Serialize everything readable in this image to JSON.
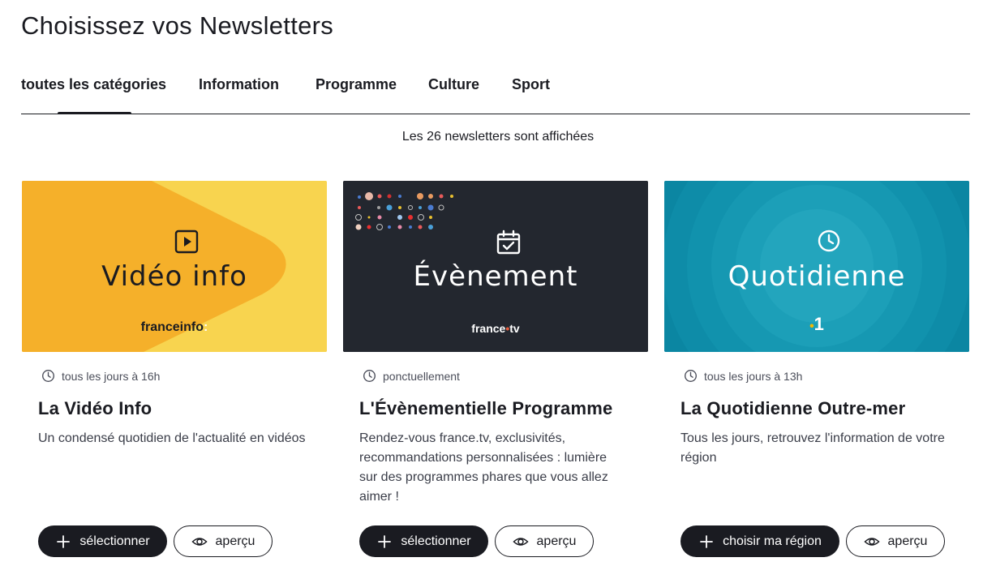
{
  "page": {
    "title": "Choisissez vos Newsletters",
    "count_text": "Les 26 newsletters sont affichées"
  },
  "tabs": [
    {
      "label": "toutes les catégories",
      "active": true
    },
    {
      "label": "Information",
      "active": false
    },
    {
      "label": "Programme",
      "active": false
    },
    {
      "label": "Culture",
      "active": false
    },
    {
      "label": "Sport",
      "active": false
    }
  ],
  "cards": [
    {
      "image_word": "Vidéo info",
      "image_brand": "franceinfo",
      "image_brand_suffix": ":",
      "icon": "play-icon",
      "frequency": "tous les jours à 16h",
      "title": "La Vidéo Info",
      "description": "Un condensé quotidien de l'actualité en vidéos",
      "primary_label": "sélectionner",
      "secondary_label": "aperçu",
      "colors": {
        "bg": "#f5b02a",
        "bg_light": "#f8d24e",
        "text": "#1a1b21"
      }
    },
    {
      "image_word": "Évènement",
      "image_brand": "france",
      "image_brand_suffix": "tv",
      "icon": "calendar-check-icon",
      "frequency": "ponctuellement",
      "title": "L'Évènementielle Programme",
      "description": "Rendez-vous france.tv, exclusivités, recommandations personnalisées : lumière sur des programmes phares que vous allez aimer !",
      "primary_label": "sélectionner",
      "secondary_label": "aperçu",
      "colors": {
        "bg": "#23272f",
        "text": "#ffffff"
      }
    },
    {
      "image_word": "Quotidienne",
      "image_brand": "1",
      "image_brand_suffix": "",
      "icon": "clock-icon",
      "frequency": "tous les jours à 13h",
      "title": "La Quotidienne Outre-mer",
      "description": "Tous les jours, retrouvez l'information de votre région",
      "primary_label": "choisir ma région",
      "secondary_label": "aperçu",
      "colors": {
        "bg": "#0e8aa6",
        "bg_light": "#2aa3bd",
        "text": "#ffffff"
      }
    }
  ]
}
